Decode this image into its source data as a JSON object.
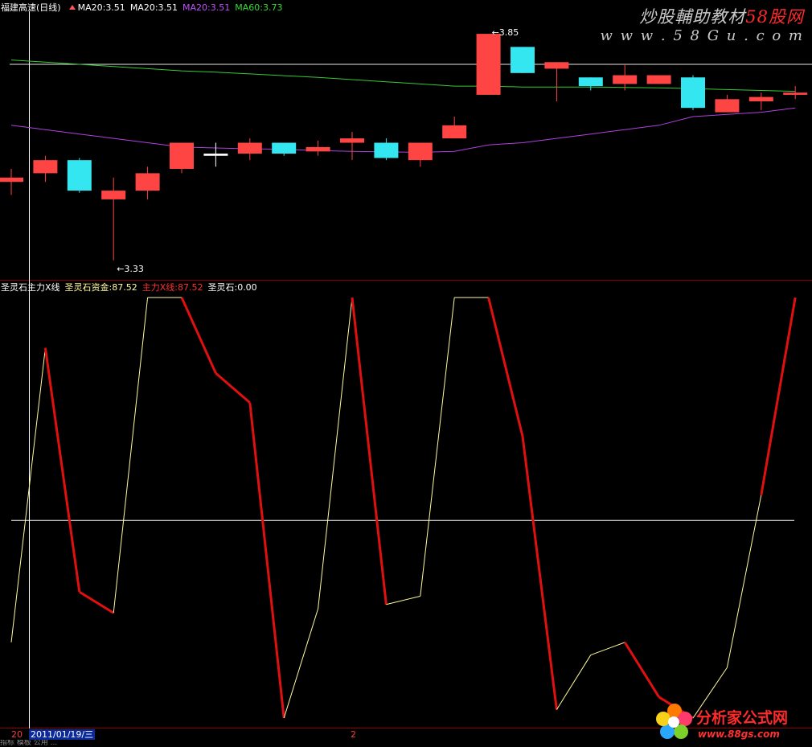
{
  "upper_header": {
    "title": "福建高速(日线)",
    "ma_a": "MA20:3.51",
    "ma_b": "MA20:3.51",
    "ma_c": "MA20:3.51",
    "ma_d": "MA60:3.73"
  },
  "lower_header": {
    "title": "圣灵石主力X线",
    "zijin": "圣灵石资金:87.52",
    "zhuli": "主力X线:87.52",
    "stone": "圣灵石:0.00"
  },
  "colors": {
    "up": "#ff4444",
    "down": "#33e6f0",
    "ma_white": "#e8e8e8",
    "ma_purple": "#b040e0",
    "ma_green": "#33cc33",
    "osc_red": "#e01010",
    "osc_yellow": "#fffaa0",
    "grid": "#8a0000"
  },
  "watermarks": {
    "top_line1_a": "炒股輔助教材",
    "top_line1_b": "58股网",
    "top_line2": "w w w . 5 8 G u . c o m",
    "bottom_line1": "分析家公式网",
    "bottom_line2": "www.88gs.com"
  },
  "date_bar": {
    "prefix": "20",
    "date": "2011/01/19/三",
    "marker": "2"
  },
  "footer_text": "指标   模板   公用   ...",
  "chart_data": [
    {
      "type": "candlestick",
      "title": "福建高速(日线)",
      "price_range": [
        3.3,
        3.9
      ],
      "annotations": [
        {
          "label": "3.85",
          "value": 3.85,
          "candle_index": 14
        },
        {
          "label": "3.33",
          "value": 3.33,
          "candle_index": 3
        }
      ],
      "candles": [
        {
          "open": 3.51,
          "close": 3.52,
          "high": 3.54,
          "low": 3.48,
          "dir": "up"
        },
        {
          "open": 3.53,
          "close": 3.56,
          "high": 3.57,
          "low": 3.51,
          "dir": "up"
        },
        {
          "open": 3.56,
          "close": 3.49,
          "high": 3.565,
          "low": 3.485,
          "dir": "down"
        },
        {
          "open": 3.47,
          "close": 3.49,
          "high": 3.52,
          "low": 3.33,
          "dir": "up"
        },
        {
          "open": 3.49,
          "close": 3.53,
          "high": 3.545,
          "low": 3.47,
          "dir": "up"
        },
        {
          "open": 3.54,
          "close": 3.6,
          "high": 3.6,
          "low": 3.53,
          "dir": "up"
        },
        {
          "open": 3.57,
          "close": 3.575,
          "high": 3.6,
          "low": 3.545,
          "dir": "flat"
        },
        {
          "open": 3.575,
          "close": 3.6,
          "high": 3.61,
          "low": 3.56,
          "dir": "up"
        },
        {
          "open": 3.6,
          "close": 3.575,
          "high": 3.6,
          "low": 3.57,
          "dir": "down"
        },
        {
          "open": 3.58,
          "close": 3.59,
          "high": 3.605,
          "low": 3.57,
          "dir": "up"
        },
        {
          "open": 3.6,
          "close": 3.61,
          "high": 3.625,
          "low": 3.56,
          "dir": "up"
        },
        {
          "open": 3.6,
          "close": 3.565,
          "high": 3.61,
          "low": 3.56,
          "dir": "down"
        },
        {
          "open": 3.56,
          "close": 3.6,
          "high": 3.6,
          "low": 3.545,
          "dir": "up"
        },
        {
          "open": 3.61,
          "close": 3.64,
          "high": 3.66,
          "low": 3.61,
          "dir": "up"
        },
        {
          "open": 3.71,
          "close": 3.85,
          "high": 3.85,
          "low": 3.71,
          "dir": "up"
        },
        {
          "open": 3.82,
          "close": 3.76,
          "high": 3.82,
          "low": 3.76,
          "dir": "down"
        },
        {
          "open": 3.77,
          "close": 3.785,
          "high": 3.785,
          "low": 3.695,
          "dir": "up"
        },
        {
          "open": 3.75,
          "close": 3.73,
          "high": 3.75,
          "low": 3.72,
          "dir": "down"
        },
        {
          "open": 3.735,
          "close": 3.755,
          "high": 3.78,
          "low": 3.72,
          "dir": "up"
        },
        {
          "open": 3.735,
          "close": 3.755,
          "high": 3.755,
          "low": 3.735,
          "dir": "up"
        },
        {
          "open": 3.75,
          "close": 3.68,
          "high": 3.755,
          "low": 3.675,
          "dir": "down"
        },
        {
          "open": 3.67,
          "close": 3.7,
          "high": 3.71,
          "low": 3.67,
          "dir": "up"
        },
        {
          "open": 3.695,
          "close": 3.705,
          "high": 3.715,
          "low": 3.675,
          "dir": "up"
        },
        {
          "open": 3.71,
          "close": 3.715,
          "high": 3.73,
          "low": 3.7,
          "dir": "up"
        }
      ],
      "ma_green": [
        3.79,
        3.785,
        3.78,
        3.775,
        3.77,
        3.765,
        3.762,
        3.758,
        3.754,
        3.75,
        3.745,
        3.74,
        3.735,
        3.73,
        3.73,
        3.728,
        3.728,
        3.728,
        3.727,
        3.726,
        3.724,
        3.722,
        3.72,
        3.718
      ],
      "ma_purple": [
        3.64,
        3.63,
        3.62,
        3.61,
        3.6,
        3.59,
        3.588,
        3.586,
        3.585,
        3.582,
        3.58,
        3.579,
        3.578,
        3.58,
        3.595,
        3.6,
        3.61,
        3.62,
        3.63,
        3.64,
        3.66,
        3.665,
        3.67,
        3.68
      ],
      "ma_white_level": 3.78
    },
    {
      "type": "line",
      "title": "圣灵石主力X线",
      "series": [
        {
          "name": "圣灵石资金",
          "values": [
            18,
            88,
            30,
            25,
            100,
            100,
            82,
            75,
            0,
            26,
            100,
            27,
            29,
            100,
            100,
            67,
            2,
            15,
            18,
            5,
            0,
            12,
            53,
            100
          ]
        }
      ],
      "zero_line": 47,
      "ylim": [
        0,
        100
      ]
    }
  ]
}
